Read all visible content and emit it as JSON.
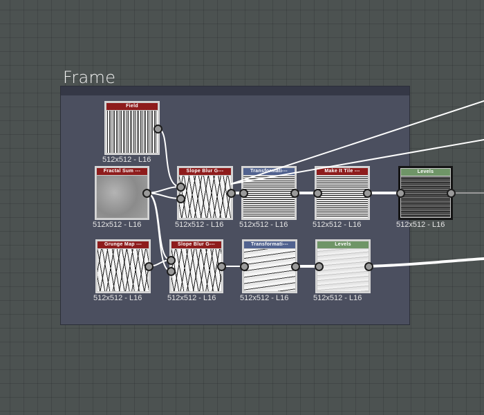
{
  "frame": {
    "title": "Frame"
  },
  "nodes": {
    "field": {
      "title": "Field",
      "resolution": "512x512 - L16"
    },
    "fractal_sum": {
      "title": "Fractal Sum ---",
      "resolution": "512x512 - L16"
    },
    "slope_blur_1": {
      "title": "Slope Blur G---",
      "resolution": "512x512 - L16"
    },
    "transformation_1": {
      "title": "Transformati---",
      "resolution": "512x512 - L16"
    },
    "make_it_tile": {
      "title": "Make It Tile ---",
      "resolution": "512x512 - L16"
    },
    "levels_1": {
      "title": "Levels",
      "resolution": "512x512 - L16"
    },
    "grunge_map": {
      "title": "Grunge Map ---",
      "resolution": "512x512 - L16"
    },
    "slope_blur_2": {
      "title": "Slope Blur G---",
      "resolution": "512x512 - L16"
    },
    "transformation_2": {
      "title": "Transformati---",
      "resolution": "512x512 - L16"
    },
    "levels_2": {
      "title": "Levels",
      "resolution": "512x512 - L16"
    }
  },
  "colors": {
    "canvas": "#4c5251",
    "frame_body": "#4b4f5f",
    "frame_header": "#353846",
    "header_red": "#8e1c1c",
    "header_blue": "#51628f",
    "header_green": "#6f9567",
    "wire": "#ffffff",
    "wire_gray": "#9a9a9a"
  }
}
